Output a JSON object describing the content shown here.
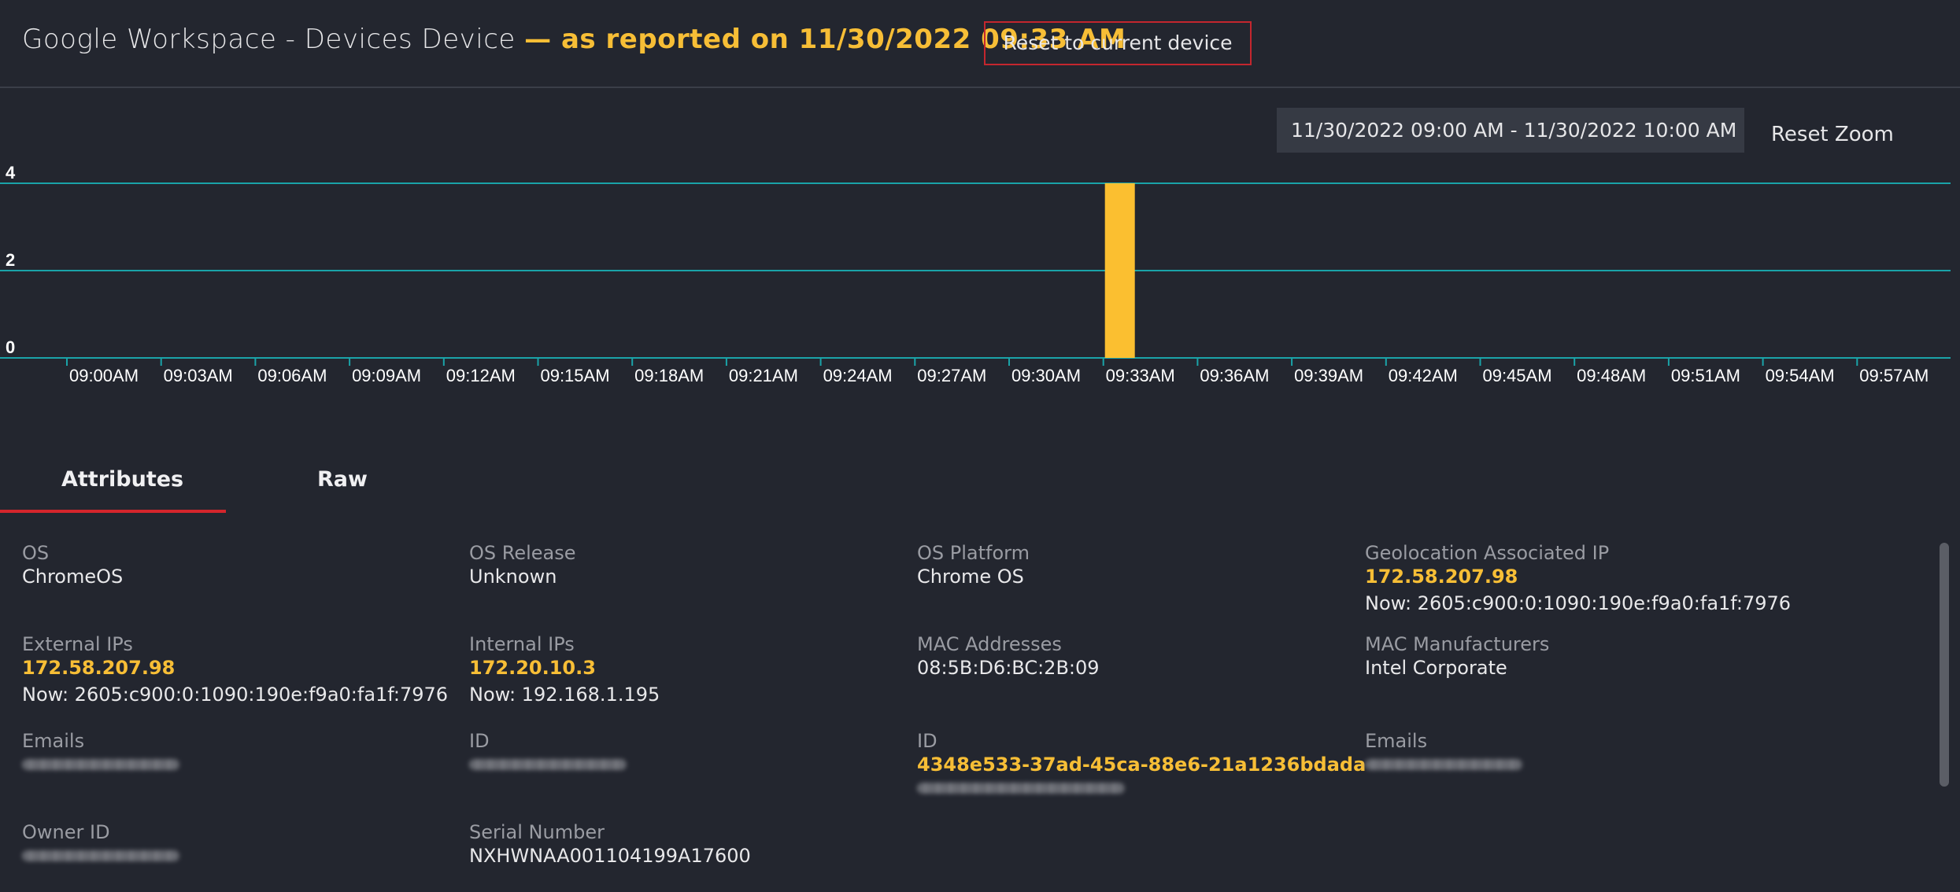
{
  "header": {
    "title_prefix": "Google Workspace - Devices Device ",
    "title_reported": "— as reported on 11/30/2022 09:33 AM",
    "reset_button": "Reset to current device"
  },
  "chart_controls": {
    "range": "11/30/2022 09:00 AM - 11/30/2022 10:00 AM",
    "reset_zoom": "Reset Zoom"
  },
  "chart_data": {
    "type": "bar",
    "categories": [
      "09:00AM",
      "09:03AM",
      "09:06AM",
      "09:09AM",
      "09:12AM",
      "09:15AM",
      "09:18AM",
      "09:21AM",
      "09:24AM",
      "09:27AM",
      "09:30AM",
      "09:33AM",
      "09:36AM",
      "09:39AM",
      "09:42AM",
      "09:45AM",
      "09:48AM",
      "09:51AM",
      "09:54AM",
      "09:57AM"
    ],
    "values": [
      0,
      0,
      0,
      0,
      0,
      0,
      0,
      0,
      0,
      0,
      0,
      4,
      0,
      0,
      0,
      0,
      0,
      0,
      0,
      0
    ],
    "yticks": [
      0,
      2,
      4
    ],
    "ylim": [
      0,
      4
    ],
    "grid": true,
    "bar_color": "#fbbf30",
    "grid_color": "#1aa3a8"
  },
  "tabs": [
    {
      "label": "Attributes"
    },
    {
      "label": "Raw"
    }
  ],
  "attributes": {
    "os": {
      "label": "OS",
      "value": "ChromeOS"
    },
    "os_release": {
      "label": "OS Release",
      "value": "Unknown"
    },
    "os_platform": {
      "label": "OS Platform",
      "value": "Chrome OS"
    },
    "geo_ip": {
      "label": "Geolocation Associated IP",
      "value": "172.58.207.98",
      "now": "Now: 2605:c900:0:1090:190e:f9a0:fa1f:7976"
    },
    "external_ips": {
      "label": "External IPs",
      "value": "172.58.207.98",
      "now": "Now: 2605:c900:0:1090:190e:f9a0:fa1f:7976"
    },
    "internal_ips": {
      "label": "Internal IPs",
      "value": "172.20.10.3",
      "now": "Now: 192.168.1.195"
    },
    "mac_addresses": {
      "label": "MAC Addresses",
      "value": "08:5B:D6:BC:2B:09"
    },
    "mac_manufacturers": {
      "label": "MAC Manufacturers",
      "value": "Intel Corporate"
    },
    "emails_1": {
      "label": "Emails"
    },
    "id_1": {
      "label": "ID"
    },
    "id_2": {
      "label": "ID",
      "value": "4348e533-37ad-45ca-88e6-21a1236bdada"
    },
    "emails_2": {
      "label": "Emails"
    },
    "owner_id": {
      "label": "Owner ID"
    },
    "serial_number": {
      "label": "Serial Number",
      "value": "NXHWNAA001104199A17600"
    }
  },
  "colors": {
    "accent": "#f7be36",
    "tab_underline": "#d4252c",
    "background": "#23262f"
  }
}
